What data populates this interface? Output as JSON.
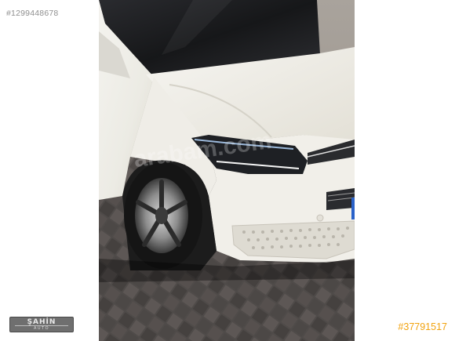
{
  "listing": {
    "id_text": "#1299448678",
    "ad_number": "#37791517"
  },
  "dealer": {
    "logo_text": "ŞAHİN",
    "logo_subtext": "AUTO"
  },
  "watermark": {
    "text": "arabam.com"
  },
  "photo": {
    "subject": "white van front quarter",
    "colors": {
      "body": "#f3f1ea",
      "pavement": "#5a5553",
      "windshield": "#1e1f22",
      "tire": "#1b1b1b",
      "accent_blue": "#2a62c9"
    }
  }
}
